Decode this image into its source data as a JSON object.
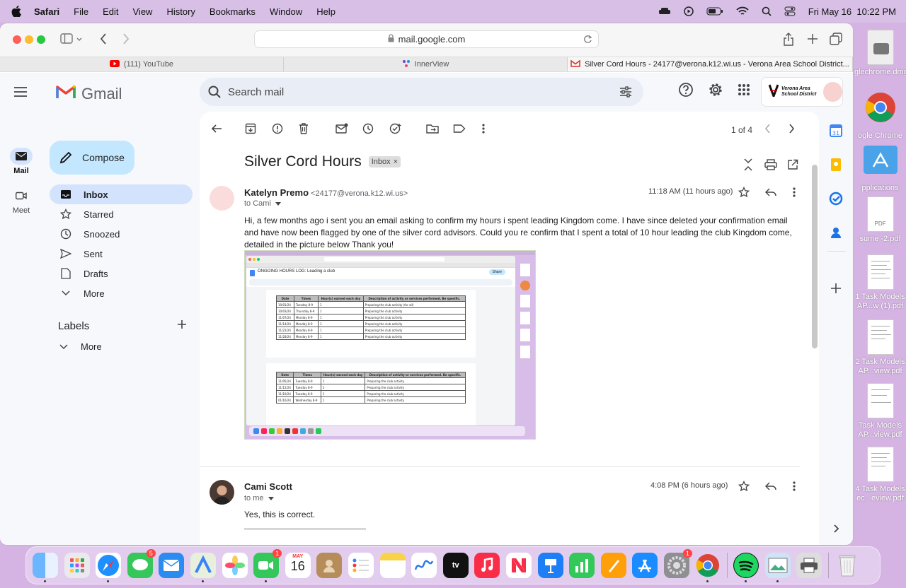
{
  "menubar": {
    "app": "Safari",
    "items": [
      "File",
      "Edit",
      "View",
      "History",
      "Bookmarks",
      "Window",
      "Help"
    ],
    "datetime": "Fri May 16  10:22 PM"
  },
  "browser": {
    "url": "mail.google.com",
    "tabs": [
      {
        "label": "(111) YouTube"
      },
      {
        "label": "InnerView"
      },
      {
        "label": "Silver Cord Hours - 24177@verona.k12.wi.us - Verona Area School District..."
      }
    ]
  },
  "gmail": {
    "logo": "Gmail",
    "search_placeholder": "Search mail",
    "org": "Verona Area School District",
    "rail": [
      {
        "label": "Mail"
      },
      {
        "label": "Meet"
      }
    ],
    "compose": "Compose",
    "nav": [
      {
        "label": "Inbox"
      },
      {
        "label": "Starred"
      },
      {
        "label": "Snoozed"
      },
      {
        "label": "Sent"
      },
      {
        "label": "Drafts"
      },
      {
        "label": "More"
      }
    ],
    "labels_title": "Labels",
    "labels_more": "More",
    "pagination": "1 of 4",
    "subject": "Silver Cord Hours",
    "subject_badge": "Inbox",
    "messages": [
      {
        "sender": "Katelyn Premo",
        "email": "<24177@verona.k12.wi.us>",
        "to": "to Cami",
        "time": "11:18 AM (11 hours ago)",
        "body": "Hi, a few months ago i sent you an email asking to confirm my hours i spent leading Kingdom come. I have since deleted your confirmation email and have now been flagged by one of the silver cord advisors. Could you re confirm that I spent a total of 10 hour leading the club Kingdom come, detailed in the picture below Thank you!"
      },
      {
        "sender": "Cami Scott",
        "to": "to me",
        "time": "4:08 PM (6 hours ago)",
        "body": "Yes, this is correct."
      }
    ]
  },
  "attachment": {
    "doc_title": "ONGOING HOURS LOG: Leading a club",
    "share": "Share",
    "headers": [
      "Date",
      "Times",
      "Hour(s) earned each day",
      "Description of activity or services performed. Be specific."
    ],
    "table1": [
      [
        "10/01/24",
        "Tuesday 8-9",
        "1",
        "Preparing the club activity (for all)"
      ],
      [
        "10/03/24",
        "Thursday 8-9",
        "1",
        "Preparing the club activity"
      ],
      [
        "11/07/24",
        "Monday 8-9",
        "1",
        "Preparing the club activity"
      ],
      [
        "11/14/24",
        "Monday 8-9",
        "1",
        "Preparing the club activity"
      ],
      [
        "11/21/24",
        "Monday 8-9",
        "1",
        "Preparing the club activity"
      ],
      [
        "11/28/24",
        "Monday 8-9",
        "1",
        "Preparing the club activity"
      ]
    ],
    "table2": [
      [
        "11/05/24",
        "Tuesday 8-9",
        "1",
        "Preparing the club activity"
      ],
      [
        "11/12/24",
        "Tuesday 8-9",
        "1",
        "Preparing the club activity"
      ],
      [
        "11/19/24",
        "Tuesday 8-9",
        "1",
        "Preparing the club activity"
      ],
      [
        "01/16/24",
        "Wednesday 8-9",
        "1",
        "Preparing the club activity"
      ]
    ]
  },
  "desktop": [
    {
      "label": "glechrome.dmg"
    },
    {
      "label": "ogle Chrome"
    },
    {
      "label": "pplications"
    },
    {
      "label": "sume -2.pdf"
    },
    {
      "label": "1 Task Models AP...w (1).pdf"
    },
    {
      "label": "2 Task Models AP...view.pdf"
    },
    {
      "label": "Task Models AP...view.pdf"
    },
    {
      "label": "4 Task Models ec...eview.pdf"
    }
  ],
  "dock": {
    "messages_badge": "5",
    "facetime_badge": "1",
    "settings_badge": "1",
    "calendar_month": "MAY",
    "calendar_day": "16"
  }
}
